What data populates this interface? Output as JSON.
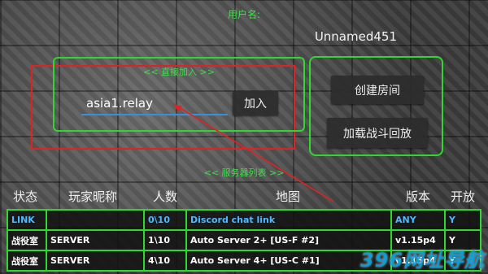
{
  "header": {
    "username_label": "用户名:",
    "username": "Unnamed451"
  },
  "direct_join": {
    "title": "<< 直接加入 >>",
    "address_value": "asia1.relay",
    "join_label": "加入"
  },
  "actions": {
    "create_room_label": "创建房间",
    "load_replay_label": "加载战斗回放"
  },
  "server_list": {
    "title": "<< 服务器列表 >>",
    "columns": [
      "状态",
      "玩家昵称",
      "人数",
      "地图",
      "版本",
      "开放"
    ],
    "rows": [
      [
        "LINK",
        "",
        "0\\10",
        "Discord chat link",
        "ANY",
        "Y"
      ],
      [
        "战役室",
        "SERVER",
        "1\\10",
        "Auto Server 2+ [US-F #2]",
        "v1.15p4",
        "Y"
      ],
      [
        "战役室",
        "SERVER",
        "4\\10",
        "Auto Server 4+ [US-C #1]",
        "v1.15p4",
        "Y"
      ]
    ]
  },
  "watermark": "396网址导航",
  "colors": {
    "accent_green": "#2fd82f",
    "highlight_red": "#e02222",
    "input_underline": "#3a8fd9",
    "link_blue": "#4fb8ff"
  }
}
